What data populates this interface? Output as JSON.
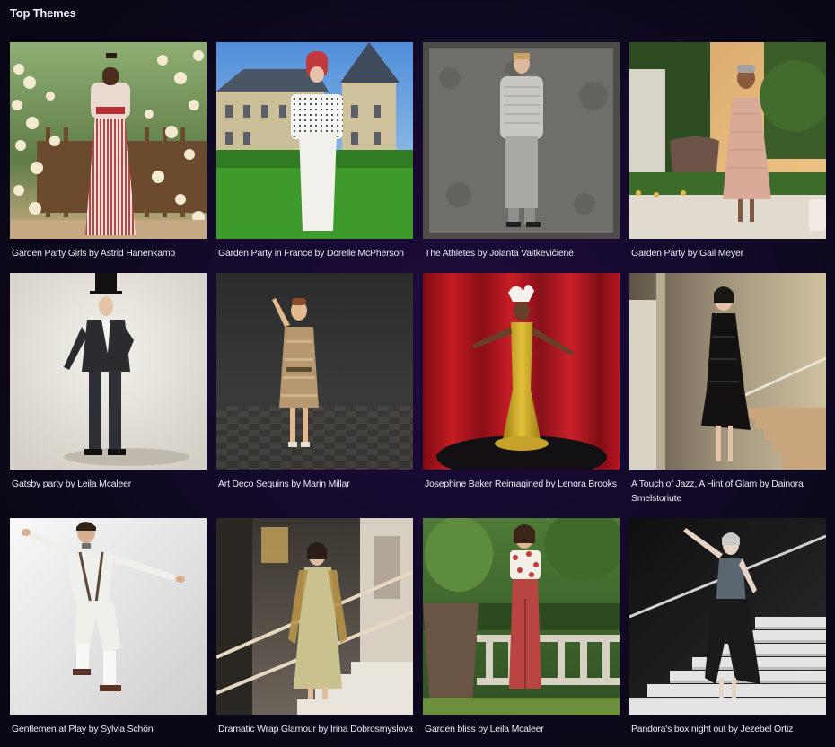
{
  "section": {
    "title": "Top Themes"
  },
  "themes": [
    {
      "caption": "Garden Party Girls by Astrid Hanenkamp"
    },
    {
      "caption": "Garden Party in France by Dorelle McPherson"
    },
    {
      "caption": "The Athletes by Jolanta Vaitkevičienė"
    },
    {
      "caption": "Garden Party by Gail Meyer"
    },
    {
      "caption": "Gatsby party by Leila Mcaleer"
    },
    {
      "caption": "Art Deco Sequins by Marin Millar"
    },
    {
      "caption": "Josephine Baker Reimagined by Lenora Brooks"
    },
    {
      "caption": "A Touch of Jazz, A Hint of Glam by Dainora Smelstoriute"
    },
    {
      "caption": "Gentlemen at Play by Sylvia Schön"
    },
    {
      "caption": "Dramatic Wrap Glamour by Irina Dobrosmyslova"
    },
    {
      "caption": "Garden bliss by Leila Mcaleer"
    },
    {
      "caption": "Pandora's box night out by Jezebel Ortiz"
    }
  ]
}
